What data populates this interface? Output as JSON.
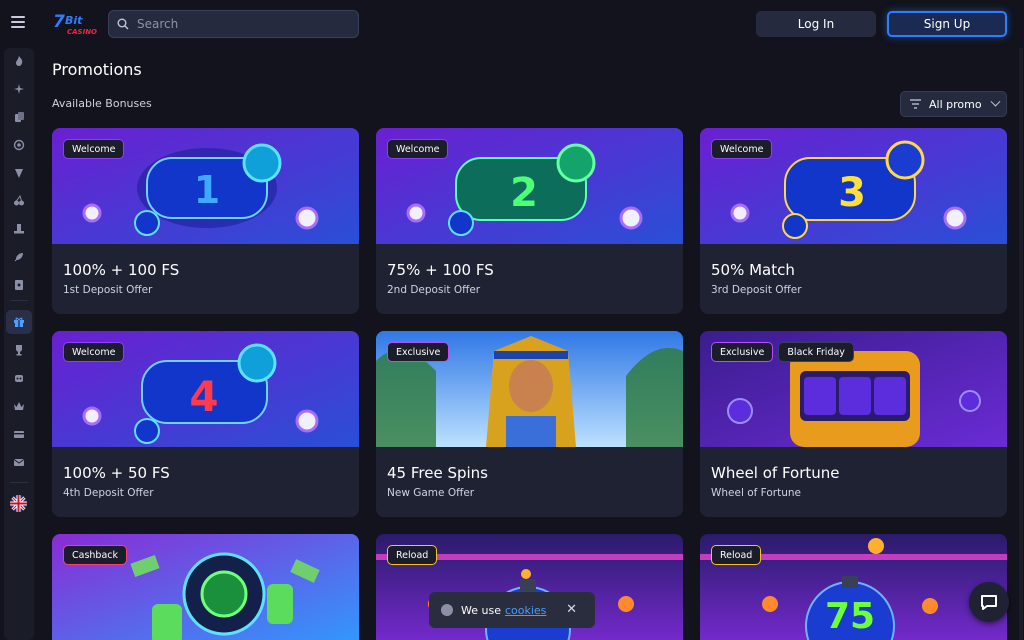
{
  "header": {
    "search_placeholder": "Search",
    "login_label": "Log In",
    "signup_label": "Sign Up"
  },
  "sidebar": {
    "icons": [
      "fire-icon",
      "star-sparkle-icon",
      "cards-icon",
      "target-icon",
      "slot-icon",
      "cherry-icon",
      "hat-icon",
      "rocket-icon",
      "card-icon",
      "gift-icon",
      "trophy-icon",
      "robot-icon",
      "crown-icon",
      "wallet-icon",
      "mail-icon"
    ],
    "active_icon": "gift-icon"
  },
  "main": {
    "title": "Promotions",
    "section_label": "Available Bonuses",
    "filter_label": "All promo"
  },
  "cards": [
    {
      "badges": [
        "Welcome"
      ],
      "title": "100% + 100 FS",
      "subtitle": "1st Deposit Offer",
      "art_number": "1"
    },
    {
      "badges": [
        "Welcome"
      ],
      "title": "75% + 100 FS",
      "subtitle": "2nd Deposit Offer",
      "art_number": "2"
    },
    {
      "badges": [
        "Welcome"
      ],
      "title": "50% Match",
      "subtitle": "3rd Deposit Offer",
      "art_number": "3"
    },
    {
      "badges": [
        "Welcome"
      ],
      "title": "100% + 50 FS",
      "subtitle": "4th Deposit Offer",
      "art_number": "4"
    },
    {
      "badges": [
        "Exclusive"
      ],
      "title": "45 Free Spins",
      "subtitle": "New Game Offer"
    },
    {
      "badges": [
        "Exclusive",
        "Black Friday"
      ],
      "title": "Wheel of Fortune",
      "subtitle": "Wheel of Fortune"
    },
    {
      "badges": [
        "Cashback"
      ]
    },
    {
      "badges": [
        "Reload"
      ]
    },
    {
      "badges": [
        "Reload"
      ],
      "art_number": "75"
    }
  ],
  "cookie": {
    "text": "We use",
    "link": "cookies"
  },
  "colors": {
    "background": "#12131c",
    "card": "#1f2233",
    "accent_blue": "#2f7dff",
    "badge_welcome": "#8a3dff",
    "badge_exclusive": "#b84cff",
    "badge_cashback": "#ff3d6e",
    "badge_reload": "#f5c518",
    "badge_blackfriday": "#3a3f58"
  }
}
